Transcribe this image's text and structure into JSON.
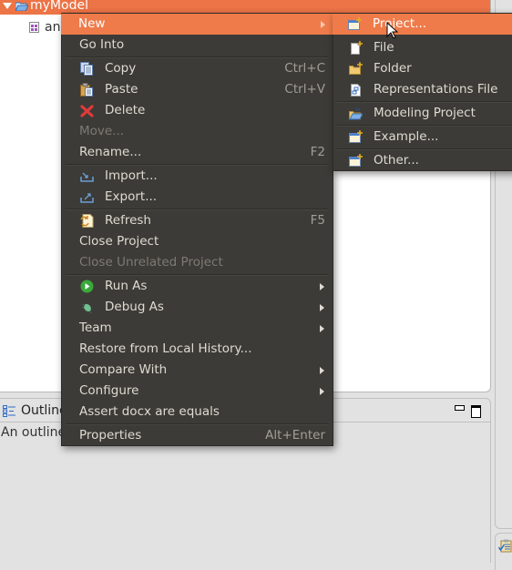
{
  "explorer": {
    "selected_item": "myModel",
    "child_item": "an"
  },
  "outline": {
    "title": "Outline",
    "message": "An outline"
  },
  "context_menu": {
    "items": [
      {
        "label": "New",
        "submenu": true,
        "highlighted": true
      },
      {
        "label": "Go Into"
      },
      {
        "label": "Copy",
        "icon": "copy-icon",
        "shortcut": "Ctrl+C"
      },
      {
        "label": "Paste",
        "icon": "paste-icon",
        "shortcut": "Ctrl+V"
      },
      {
        "label": "Delete",
        "icon": "delete-icon"
      },
      {
        "label": "Move...",
        "disabled": true
      },
      {
        "label": "Rename...",
        "shortcut": "F2"
      },
      {
        "label": "Import...",
        "icon": "import-icon"
      },
      {
        "label": "Export...",
        "icon": "export-icon"
      },
      {
        "label": "Refresh",
        "icon": "refresh-icon",
        "shortcut": "F5"
      },
      {
        "label": "Close Project"
      },
      {
        "label": "Close Unrelated Project",
        "disabled": true
      },
      {
        "label": "Run As",
        "icon": "run-icon",
        "submenu": true
      },
      {
        "label": "Debug As",
        "icon": "debug-icon",
        "submenu": true
      },
      {
        "label": "Team",
        "submenu": true
      },
      {
        "label": "Restore from Local History..."
      },
      {
        "label": "Compare With",
        "submenu": true
      },
      {
        "label": "Configure",
        "submenu": true
      },
      {
        "label": "Assert docx are equals"
      },
      {
        "label": "Properties",
        "shortcut": "Alt+Enter"
      }
    ]
  },
  "new_submenu": {
    "items": [
      {
        "label": "Project...",
        "icon": "new-project-icon",
        "highlighted": true
      },
      {
        "label": "File",
        "icon": "new-file-icon"
      },
      {
        "label": "Folder",
        "icon": "new-folder-icon"
      },
      {
        "label": "Representations File",
        "icon": "representations-file-icon"
      },
      {
        "label": "Modeling Project",
        "icon": "modeling-project-icon"
      },
      {
        "label": "Example...",
        "icon": "new-example-icon"
      },
      {
        "label": "Other...",
        "icon": "new-other-icon"
      }
    ]
  },
  "colors": {
    "accent": "#ef7b4a",
    "menu_bg": "#3c3b37",
    "menu_text": "#dfdbd2",
    "disabled_text": "#7d7a73"
  }
}
